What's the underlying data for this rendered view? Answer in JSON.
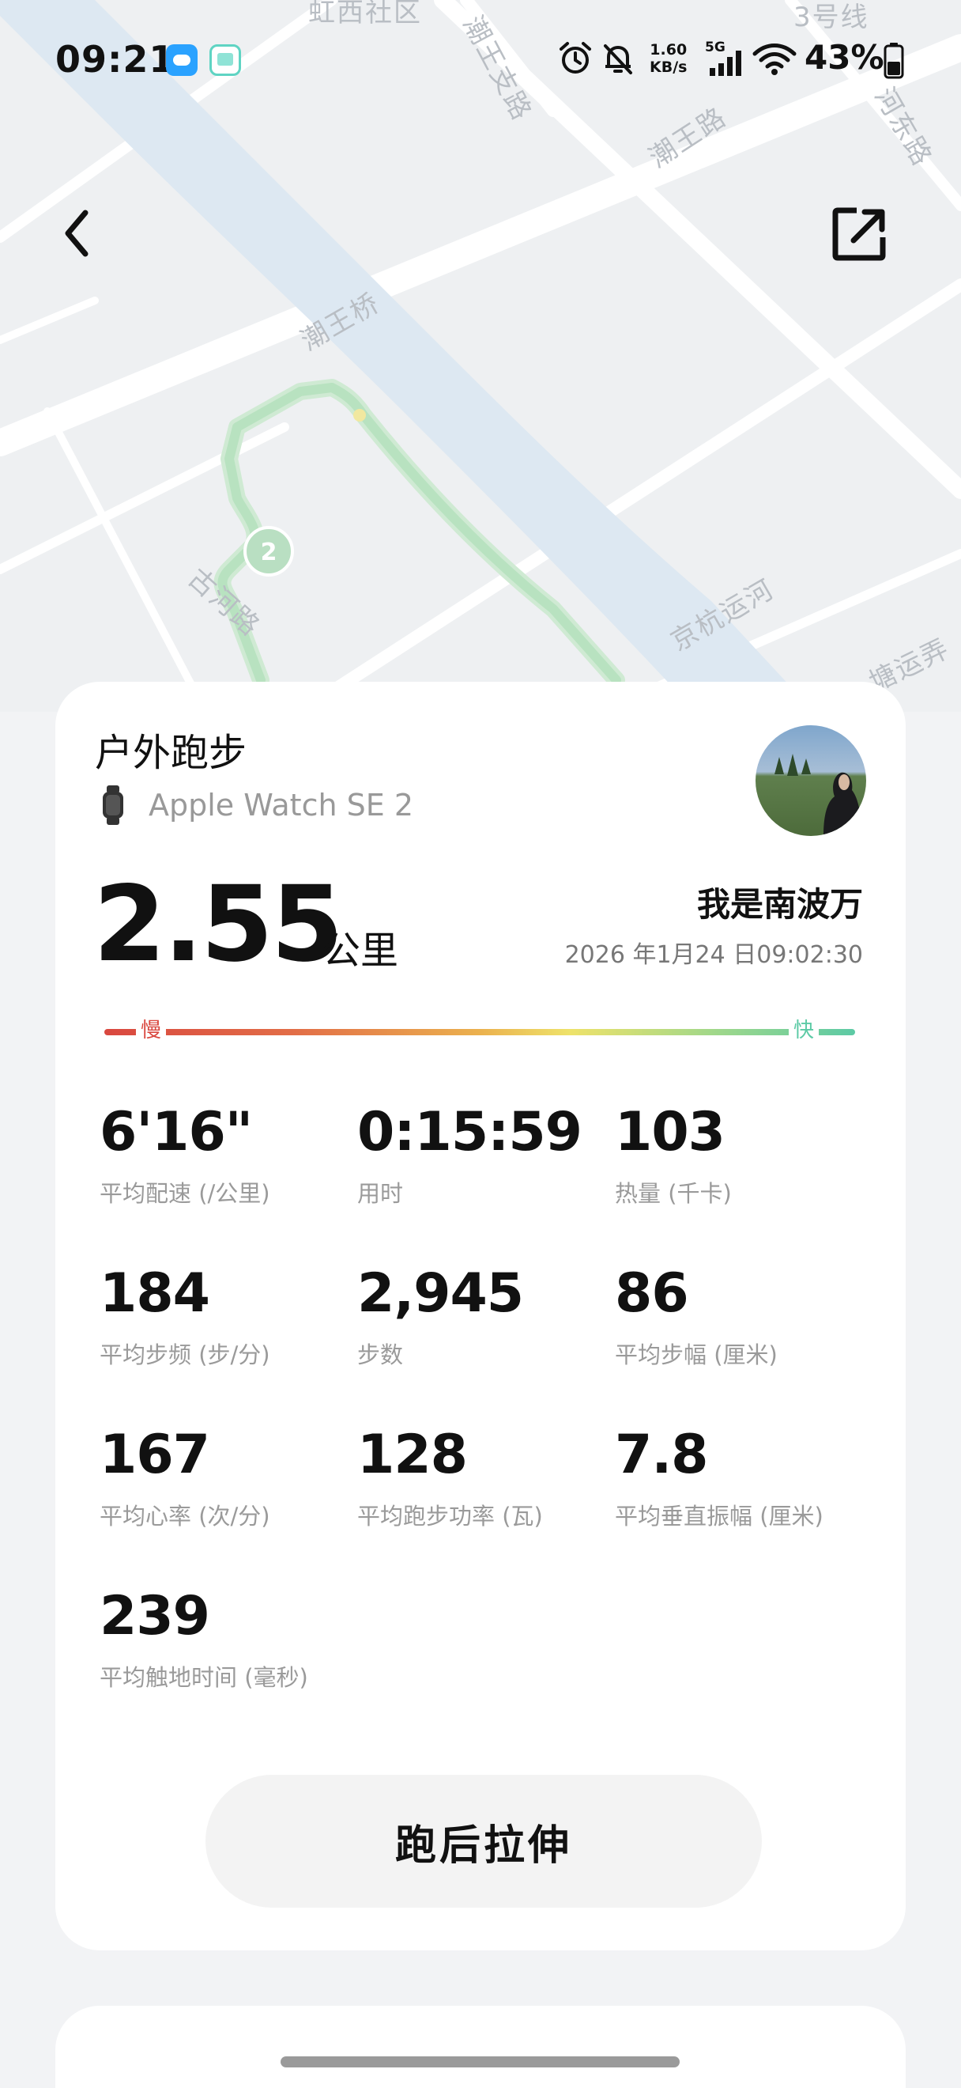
{
  "status_bar": {
    "time": "09:21",
    "net_speed_value": "1.60",
    "net_speed_unit": "KB/s",
    "network_type": "5G",
    "battery_percent": "43%",
    "icons": [
      "weather-app-icon",
      "message-app-icon",
      "alarm-icon",
      "mute-icon",
      "signal-icon",
      "wifi-icon",
      "battery-icon"
    ]
  },
  "map": {
    "labels": [
      "虹西社区",
      "潮王支路",
      "3号线",
      "潮王路",
      "河东路",
      "潮王桥",
      "古河路",
      "京杭运河",
      "塘运弄"
    ],
    "route_marker": "2"
  },
  "header": {
    "back_icon": "chevron-left-icon",
    "share_icon": "share-icon"
  },
  "workout": {
    "title": "户外跑步",
    "device": "Apple Watch SE 2",
    "distance": "2.55",
    "distance_unit": "公里",
    "user_name": "我是南波万",
    "date": "2026 年1月24 日09:02:30",
    "pace_scale": {
      "slow": "慢",
      "fast": "快"
    },
    "metrics": [
      {
        "value": "6'16\"",
        "label": "平均配速 (/公里)"
      },
      {
        "value": "0:15:59",
        "label": "用时"
      },
      {
        "value": "103",
        "label": "热量 (千卡)"
      },
      {
        "value": "184",
        "label": "平均步频 (步/分)"
      },
      {
        "value": "2,945",
        "label": "步数"
      },
      {
        "value": "86",
        "label": "平均步幅 (厘米)"
      },
      {
        "value": "167",
        "label": "平均心率 (次/分)"
      },
      {
        "value": "128",
        "label": "平均跑步功率 (瓦)"
      },
      {
        "value": "7.8",
        "label": "平均垂直振幅 (厘米)"
      },
      {
        "value": "239",
        "label": "平均触地时间 (毫秒)"
      }
    ],
    "stretch_button": "跑后拉伸"
  },
  "colors": {
    "pace_slow": "#d9473f",
    "pace_fast": "#5ccaa5",
    "route": "#b8e2c0",
    "river": "#dde8f2"
  }
}
